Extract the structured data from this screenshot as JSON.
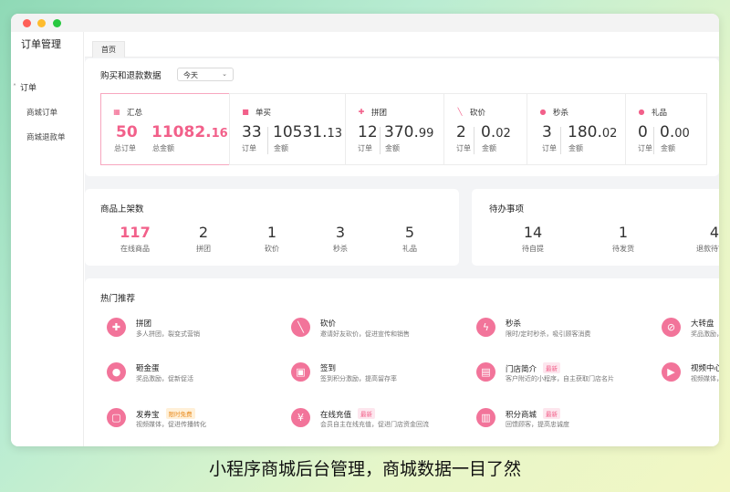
{
  "sidebar": {
    "title": "订单管理",
    "group": "订单",
    "items": [
      {
        "label": "商城订单"
      },
      {
        "label": "商城退款单"
      }
    ]
  },
  "tabs": [
    {
      "label": "首页"
    }
  ],
  "purchase": {
    "title": "购买和退款数据",
    "select_value": "今天",
    "cards": [
      {
        "name": "汇总",
        "icon": "grid-icon",
        "count": "50",
        "count_label": "总订单",
        "amount_int": "11082.",
        "amount_dec": "16",
        "amount_label": "总金额"
      },
      {
        "name": "单买",
        "icon": "bookmark-icon",
        "count": "33",
        "count_label": "订单",
        "amount_int": "10531.",
        "amount_dec": "13",
        "amount_label": "金额"
      },
      {
        "name": "拼团",
        "icon": "puzzle-icon",
        "count": "12",
        "count_label": "订单",
        "amount_int": "370.",
        "amount_dec": "99",
        "amount_label": "金额"
      },
      {
        "name": "砍价",
        "icon": "knife-icon",
        "count": "2",
        "count_label": "订单",
        "amount_int": "0.",
        "amount_dec": "02",
        "amount_label": "金额"
      },
      {
        "name": "秒杀",
        "icon": "clock-icon",
        "count": "3",
        "count_label": "订单",
        "amount_int": "180.",
        "amount_dec": "02",
        "amount_label": "金额"
      },
      {
        "name": "礼品",
        "icon": "gift-icon",
        "count": "0",
        "count_label": "订单",
        "amount_int": "0.",
        "amount_dec": "00",
        "amount_label": "金额"
      }
    ]
  },
  "products": {
    "title": "商品上架数",
    "stats": [
      {
        "value": "117",
        "label": "在线商品"
      },
      {
        "value": "2",
        "label": "拼团"
      },
      {
        "value": "1",
        "label": "砍价"
      },
      {
        "value": "3",
        "label": "秒杀"
      },
      {
        "value": "5",
        "label": "礼品"
      }
    ]
  },
  "todo": {
    "title": "待办事项",
    "stats": [
      {
        "value": "14",
        "label": "待自提"
      },
      {
        "value": "1",
        "label": "待发货"
      },
      {
        "value": "4",
        "label": "退款待审核"
      }
    ]
  },
  "recommend": {
    "title": "热门推荐",
    "items": [
      {
        "name": "拼团",
        "desc": "多人拼团，裂变式营销",
        "badge": "",
        "icon": "puzzle-icon"
      },
      {
        "name": "砍价",
        "desc": "邀请好友砍价，促进宣传和销售",
        "badge": "",
        "icon": "knife-icon"
      },
      {
        "name": "秒杀",
        "desc": "限时/定时秒杀，吸引顾客消费",
        "badge": "",
        "icon": "lightning-icon"
      },
      {
        "name": "大转盘",
        "desc": "奖品激励，",
        "badge": "",
        "icon": "wheel-icon"
      },
      {
        "name": "砸金蛋",
        "desc": "奖品激励，促新促活",
        "badge": "",
        "icon": "egg-icon"
      },
      {
        "name": "签到",
        "desc": "签到积分激励，提高留存率",
        "badge": "",
        "icon": "calendar-icon"
      },
      {
        "name": "门店简介",
        "desc": "客户附近的小程序，自主获取门店名片",
        "badge": "最新",
        "icon": "store-icon"
      },
      {
        "name": "视频中心",
        "desc": "视频媒体，",
        "badge": "",
        "icon": "video-icon"
      },
      {
        "name": "发券宝",
        "desc": "视频媒体，促进传播转化",
        "badge": "限时免费",
        "icon": "coupon-icon"
      },
      {
        "name": "在线充值",
        "desc": "会员自主在线充值，促进门店资金回流",
        "badge": "最新",
        "icon": "wallet-icon"
      },
      {
        "name": "积分商城",
        "desc": "回馈顾客，提高忠诚度",
        "badge": "最新",
        "icon": "shop-icon"
      }
    ]
  },
  "caption": "小程序商城后台管理，商城数据一目了然",
  "colors": {
    "accent": "#f2608a",
    "icon_bg": "#f2749a"
  }
}
